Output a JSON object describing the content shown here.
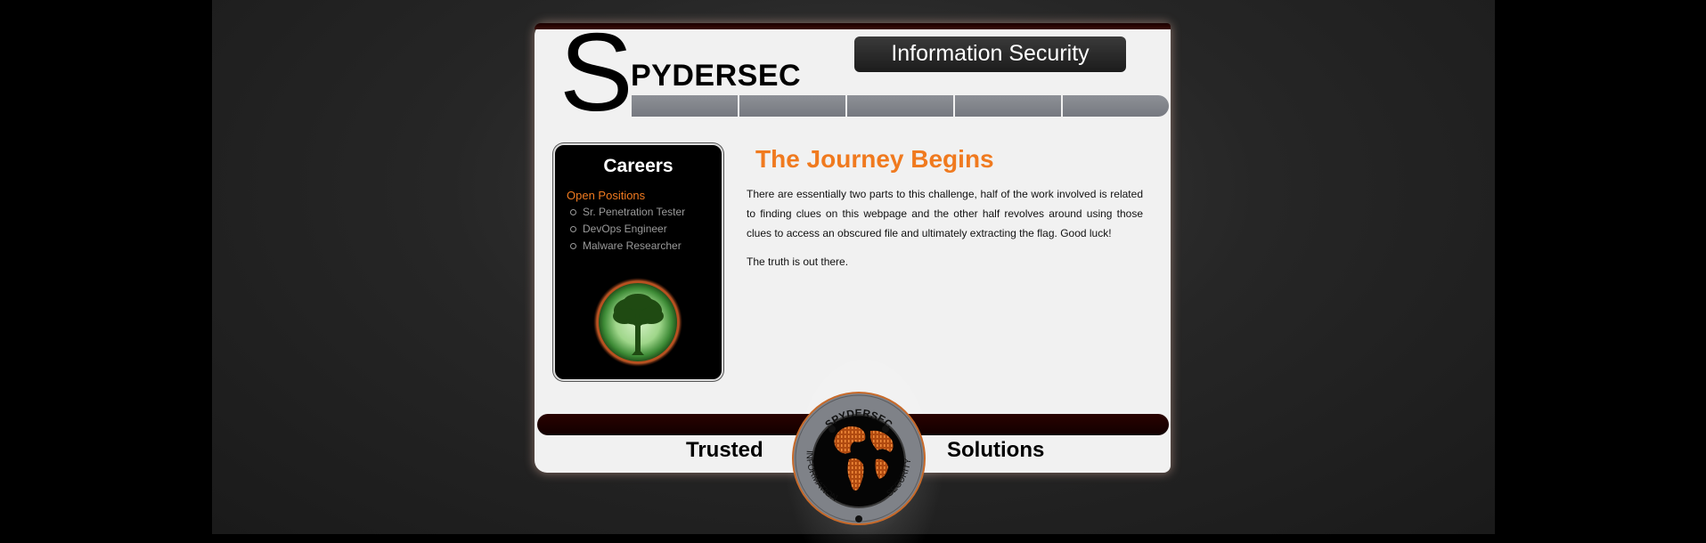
{
  "header": {
    "logo_initial": "S",
    "logo_rest": "PYDERSEC",
    "tagline": "Information Security"
  },
  "nav": {
    "items": [
      "",
      "",
      "",
      "",
      ""
    ]
  },
  "sidebar": {
    "title": "Careers",
    "subtitle": "Open Positions",
    "positions": [
      "Sr. Penetration Tester",
      "DevOps Engineer",
      "Malware Researcher"
    ]
  },
  "main": {
    "title": "The Journey Begins",
    "paragraphs": [
      "There are essentially two parts to this challenge, half of the work involved is related to finding clues on this webpage and the other half revolves around using those clues to access an obscured file and ultimately extracting the flag. Good luck!",
      "The truth is out there."
    ]
  },
  "footer": {
    "left_text": "Trusted",
    "right_text": "Solutions",
    "badge_top": "SPYDERSEC",
    "badge_left": "INFORMATION",
    "badge_right": "SECURITY"
  },
  "colors": {
    "accent": "#f07a1f",
    "nav": "#808389",
    "footer_bar": "#1c0100"
  }
}
